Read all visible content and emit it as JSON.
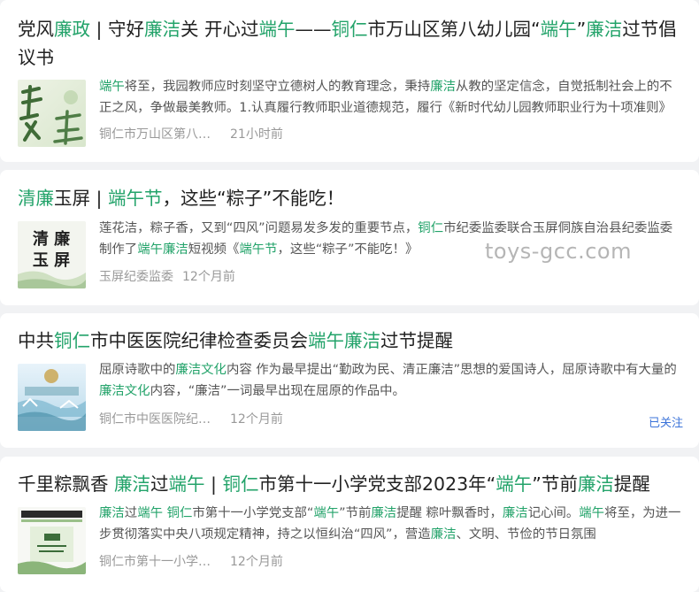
{
  "watermark": "toys-gcc.com",
  "colors": {
    "highlight": "#23a36a",
    "follow": "#3b73d9",
    "background": "#f1f2f4"
  },
  "articles": [
    {
      "title": [
        {
          "t": "党风",
          "h": false
        },
        {
          "t": "廉政",
          "h": true
        },
        {
          "t": " | 守好",
          "h": false
        },
        {
          "t": "廉洁",
          "h": true
        },
        {
          "t": "关 开心过",
          "h": false
        },
        {
          "t": "端午",
          "h": true
        },
        {
          "t": "——",
          "h": false
        },
        {
          "t": "铜仁",
          "h": true
        },
        {
          "t": "市万山区第八幼儿园“",
          "h": false
        },
        {
          "t": "端午",
          "h": true
        },
        {
          "t": "”",
          "h": false
        },
        {
          "t": "廉洁",
          "h": true
        },
        {
          "t": "过节倡议书",
          "h": false
        }
      ],
      "summary": [
        {
          "t": "端午",
          "h": true
        },
        {
          "t": "将至，我园教师应时刻坚守立德树人的教育理念，秉持",
          "h": false
        },
        {
          "t": "廉洁",
          "h": true
        },
        {
          "t": "从教的坚定信念，自觉抵制社会上的不正之风，争做最美教师。1.认真履行教师职业道德规范，履行《新时代幼儿园教师职业行为十项准则》",
          "h": false
        }
      ],
      "source": "铜仁市万山区第八幼儿园",
      "time": "21小时前",
      "thumb": "lian-jie-calligraphy"
    },
    {
      "title": [
        {
          "t": "清廉",
          "h": true
        },
        {
          "t": "玉屏 | ",
          "h": false
        },
        {
          "t": "端午节",
          "h": true
        },
        {
          "t": "，这些“粽子”不能吃！",
          "h": false
        }
      ],
      "summary": [
        {
          "t": "莲花洁，粽子香，又到“四风”问题易发多发的重要节点，",
          "h": false
        },
        {
          "t": "铜仁",
          "h": true
        },
        {
          "t": "市纪委监委联合玉屏侗族自治县纪委监委制作了",
          "h": false
        },
        {
          "t": "端午廉洁",
          "h": true
        },
        {
          "t": "短视频《",
          "h": false
        },
        {
          "t": "端午节",
          "h": true
        },
        {
          "t": "，这些“粽子”不能吃！》",
          "h": false
        }
      ],
      "source": "玉屏纪委监委",
      "time": "12个月前",
      "thumb": "qing-lian-yu-ping-calligraphy",
      "thumb_text": [
        "清 廉",
        "玉 屏"
      ]
    },
    {
      "title": [
        {
          "t": "中共",
          "h": false
        },
        {
          "t": "铜仁",
          "h": true
        },
        {
          "t": "市中医医院纪律检查委员会",
          "h": false
        },
        {
          "t": "端午廉洁",
          "h": true
        },
        {
          "t": "过节提醒",
          "h": false
        }
      ],
      "summary": [
        {
          "t": "屈原诗歌中的",
          "h": false
        },
        {
          "t": "廉洁文化",
          "h": true
        },
        {
          "t": "内容 作为最早提出“勤政为民、清正廉洁”思想的爱国诗人，屈原诗歌中有大量的",
          "h": false
        },
        {
          "t": "廉洁文化",
          "h": true
        },
        {
          "t": "内容，“廉洁”一词最早出现在屈原的作品中。",
          "h": false
        }
      ],
      "source": "铜仁市中医医院纪律检查委员会",
      "time": "12个月前",
      "follow": "已关注",
      "thumb": "festival-banner"
    },
    {
      "title": [
        {
          "t": "千里粽飘香 ",
          "h": false
        },
        {
          "t": "廉洁",
          "h": true
        },
        {
          "t": "过",
          "h": false
        },
        {
          "t": "端午",
          "h": true
        },
        {
          "t": " | ",
          "h": false
        },
        {
          "t": "铜仁",
          "h": true
        },
        {
          "t": "市第十一小学党支部2023年“",
          "h": false
        },
        {
          "t": "端午",
          "h": true
        },
        {
          "t": "”节前",
          "h": false
        },
        {
          "t": "廉洁",
          "h": true
        },
        {
          "t": "提醒",
          "h": false
        }
      ],
      "summary": [
        {
          "t": "廉洁",
          "h": true
        },
        {
          "t": "过",
          "h": false
        },
        {
          "t": "端午",
          "h": true
        },
        {
          "t": " ",
          "h": false
        },
        {
          "t": "铜仁",
          "h": true
        },
        {
          "t": "市第十一小学党支部“",
          "h": false
        },
        {
          "t": "端午",
          "h": true
        },
        {
          "t": "”节前",
          "h": false
        },
        {
          "t": "廉洁",
          "h": true
        },
        {
          "t": "提醒 粽叶飘香时，",
          "h": false
        },
        {
          "t": "廉洁",
          "h": true
        },
        {
          "t": "记心间。",
          "h": false
        },
        {
          "t": "端午",
          "h": true
        },
        {
          "t": "将至，为进一步贯彻落实中央八项规定精神，持之以恒纠治“四风”，营造",
          "h": false
        },
        {
          "t": "廉洁",
          "h": true
        },
        {
          "t": "、文明、节俭的节日氛围",
          "h": false
        }
      ],
      "source": "铜仁市第十一小学党支部",
      "time": "12个月前",
      "thumb": "school-notice-poster"
    }
  ]
}
